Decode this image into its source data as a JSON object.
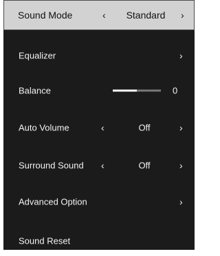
{
  "menu": {
    "sound_mode": {
      "label": "Sound Mode",
      "value": "Standard",
      "left_arrow": "‹",
      "right_arrow": "›"
    },
    "equalizer": {
      "label": "Equalizer",
      "right_arrow": "›"
    },
    "balance": {
      "label": "Balance",
      "value": "0",
      "level_fraction": 0.5
    },
    "auto_volume": {
      "label": "Auto Volume",
      "value": "Off",
      "left_arrow": "‹",
      "right_arrow": "›"
    },
    "surround_sound": {
      "label": "Surround Sound",
      "value": "Off",
      "left_arrow": "‹",
      "right_arrow": "›"
    },
    "advanced_option": {
      "label": "Advanced Option",
      "right_arrow": "›"
    },
    "sound_reset": {
      "label": "Sound Reset"
    }
  },
  "colors": {
    "menu_background": "#1b1b1b",
    "selected_background": "#d2d2d2",
    "text": "#f2f2f2",
    "selected_text": "#111111",
    "slider_track": "#7a7a7a",
    "slider_fill": "#ffffff"
  }
}
